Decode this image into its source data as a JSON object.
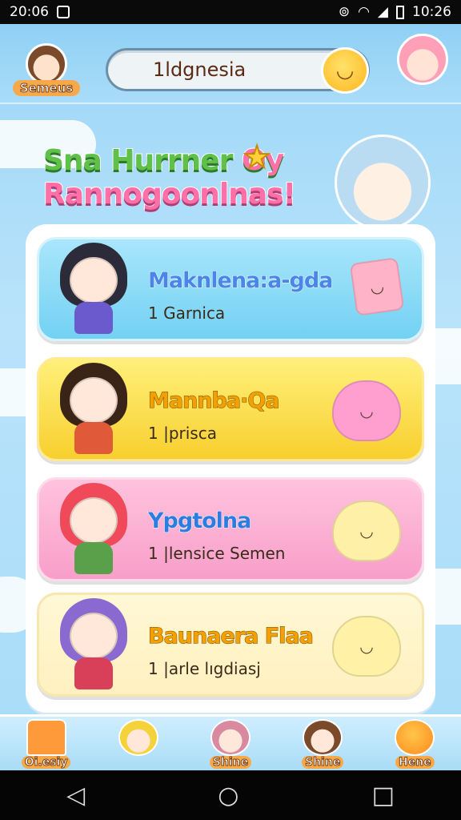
{
  "status_bar": {
    "time": "20:06",
    "right_time": "10:26"
  },
  "header": {
    "left_avatar_label": "Semeus",
    "search_text": "1ldgnesia"
  },
  "banner": {
    "title_line1": "Sna Hurrner",
    "title_line1_tail": "Oy",
    "title_line2": "Rannogoonlnas!"
  },
  "cards": [
    {
      "name": "Maknlena:a-gda",
      "subtitle": "1 Garnica",
      "name_color": "#4a86e8",
      "pet": "notebook-pet"
    },
    {
      "name": "Mannba·Qa",
      "subtitle": "1 |prisca",
      "name_color": "#f2a100",
      "pet": "pink-slime-pet"
    },
    {
      "name": "Ypgtolna",
      "subtitle": "1 |lensice Semen",
      "name_color": "#2d7de0",
      "pet": "cat-slime-pet"
    },
    {
      "name": "Baunaera Flaa",
      "subtitle": "1 |arle lıgdiasj",
      "name_color": "#f2a100",
      "pet": "yellow-slime-pet"
    }
  ],
  "bottom_nav": [
    {
      "label": "Oi.esiy",
      "icon": "home-icon"
    },
    {
      "label": "",
      "icon": "character-icon"
    },
    {
      "label": "Shine",
      "icon": "avatar-icon"
    },
    {
      "label": "Shine",
      "icon": "avatar-icon"
    },
    {
      "label": "Hene",
      "icon": "orange-icon"
    }
  ],
  "colors": {
    "sky": "#a8dcf8",
    "accent_orange": "#f7a94a",
    "pink": "#ff6fa8",
    "green": "#5fc04a"
  }
}
